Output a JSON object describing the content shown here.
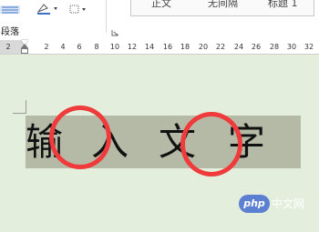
{
  "ribbon": {
    "paragraph_group_label": "段落",
    "styles": [
      "正文",
      "无间隔",
      "标题 1"
    ]
  },
  "ruler": {
    "ticks": [
      "2",
      "2",
      "4",
      "6",
      "8",
      "10",
      "12",
      "14",
      "16",
      "18",
      "20",
      "22",
      "24",
      "26",
      "28",
      "30",
      "32"
    ]
  },
  "document": {
    "characters": [
      "输",
      "入",
      "文",
      "字"
    ],
    "highlight_color": "#ef3b3b",
    "selection_color": "#b5baa7"
  },
  "watermark": {
    "logo": "php",
    "site": "中文网"
  }
}
